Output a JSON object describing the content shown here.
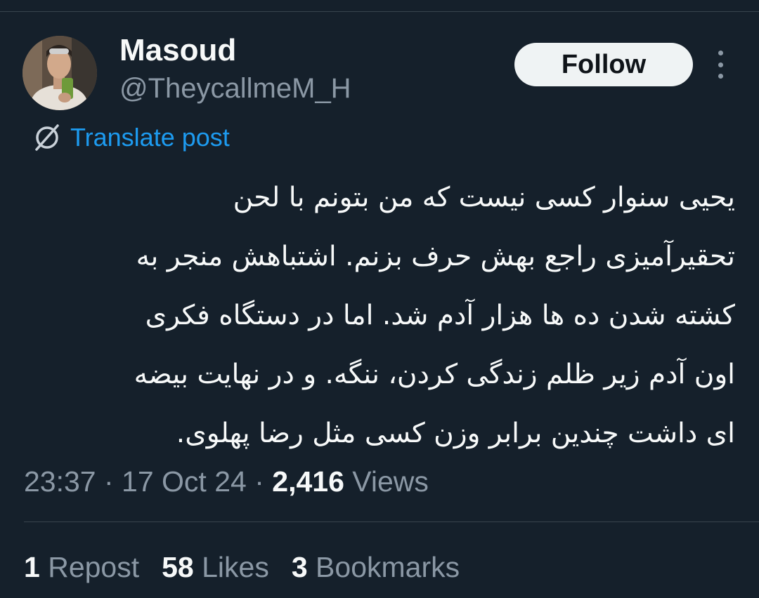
{
  "user": {
    "display_name": "Masoud",
    "handle": "@TheycallmeM_H",
    "follow_label": "Follow",
    "more_icon": "more-icon"
  },
  "translate": {
    "label": "Translate post",
    "icon": "translate-icon",
    "color": "#1d9bf0"
  },
  "post": {
    "lines": [
      "یحیی سنوار کسی نیست که من بتونم با لحن",
      "تحقیرآمیزی راجع بهش حرف بزنم. اشتباهش منجر به",
      "کشته شدن ده ها هزار آدم شد. اما در دستگاه فکری",
      "اون آدم زیر ظلم زندگی کردن، ننگه. و در نهایت بیضه",
      "ای داشت چندین برابر وزن کسی مثل رضا پهلوی."
    ]
  },
  "meta": {
    "time": "23:37",
    "sep1": " · ",
    "date": "17 Oct 24",
    "sep2": " · ",
    "views_count": "2,416",
    "views_label": " Views"
  },
  "stats": {
    "reposts_count": "1",
    "reposts_label": " Repost",
    "likes_count": "58",
    "likes_label": " Likes",
    "bookmarks_count": "3",
    "bookmarks_label": " Bookmarks"
  },
  "colors": {
    "background": "#15202b",
    "primary_text": "#f7f9f9",
    "secondary_text": "#8b98a5",
    "divider": "#38444d"
  }
}
